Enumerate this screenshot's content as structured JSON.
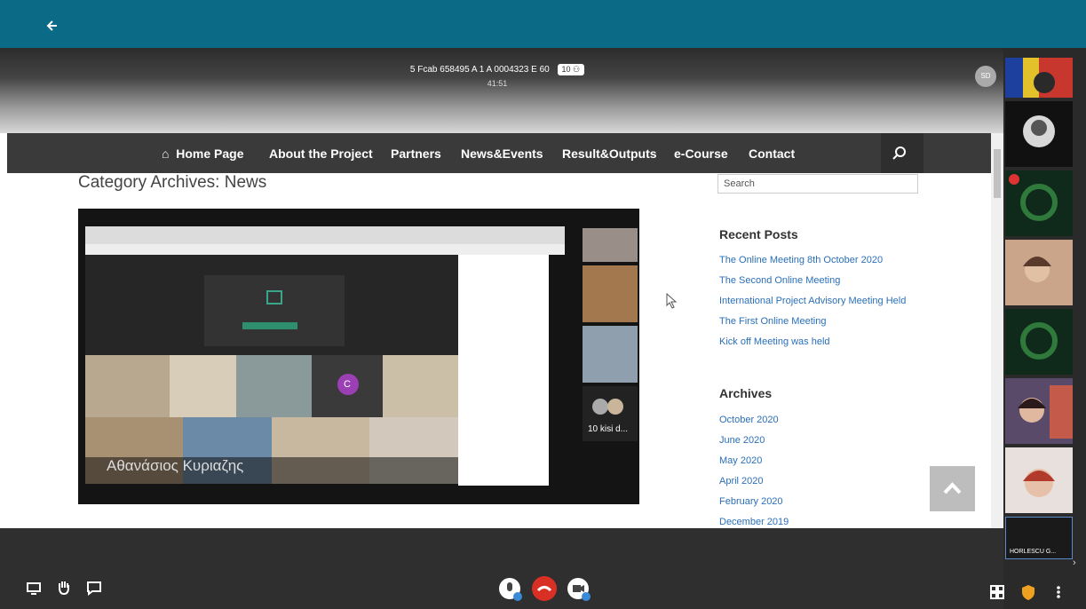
{
  "meeting": {
    "title": "5 Fcab 658495 A 1 A 0004323 E 60",
    "participant_count": "10",
    "elapsed": "41:51",
    "self_initials": "SD"
  },
  "site": {
    "nav": [
      "Home Page",
      "About the Project",
      "Partners",
      "News&Events",
      "Result&Outputs",
      "e-Course",
      "Contact"
    ],
    "category_title": "Category Archives: News",
    "search_placeholder": "Search",
    "recent_posts_title": "Recent Posts",
    "recent_posts": [
      "The Online Meeting 8th October 2020",
      "The Second Online Meeting",
      "International Project Advisory Meeting Held",
      "The First Online Meeting",
      "Kick off Meeting was held"
    ],
    "archives_title": "Archives",
    "archives": [
      "October 2020",
      "June 2020",
      "May 2020",
      "April 2020",
      "February 2020",
      "December 2019"
    ]
  },
  "thumbnail": {
    "speaker_name": "Αθανάσιος Κυριαζης",
    "others_label": "10 kisi d...",
    "avatar_letter": "C"
  },
  "participants": {
    "last_name": "HORLESCU G..."
  },
  "colors": {
    "topbar": "#0b6a85",
    "link": "#2a6fb8",
    "end_call": "#d93025"
  }
}
